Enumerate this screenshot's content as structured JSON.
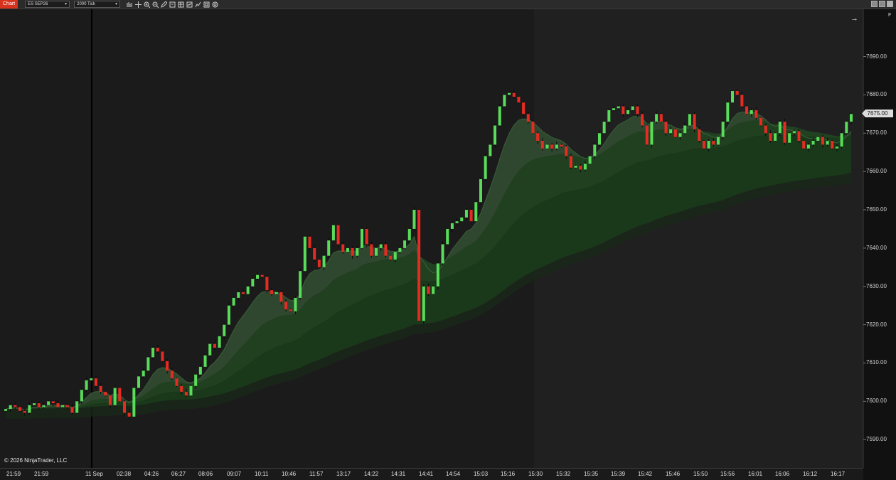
{
  "window": {
    "tab_label": "Chart"
  },
  "toolbar": {
    "instrument": "ES SEP26",
    "period": "2000 Tick",
    "icons": [
      "bar-type-icon",
      "crosshair-icon",
      "zoom-in-icon",
      "zoom-out-icon",
      "pencil-icon",
      "attach-order-icon",
      "data-box-icon",
      "indicators-icon",
      "strategies-icon",
      "chart-trader-icon",
      "properties-icon"
    ]
  },
  "colors": {
    "background": "#1b1b1b",
    "session_shade": "#202020",
    "up": "#59dc59",
    "down": "#e52c22",
    "ribbon_1": "#2f4a2f",
    "ribbon_2": "#214221",
    "ribbon_3": "#1a3a1a",
    "ribbon_4": "#1a2a1a"
  },
  "panel": {
    "copyright": "© 2026 NinjaTrader, LLC",
    "side_label": "F"
  },
  "price_axis": {
    "ticks": [
      "7690.00",
      "7680.00",
      "7670.00",
      "7660.00",
      "7650.00",
      "7640.00",
      "7630.00",
      "7620.00",
      "7610.00",
      "7600.00",
      "7590.00"
    ],
    "current_price": "7675.00"
  },
  "time_axis": {
    "labels": [
      "21:59",
      "21:59",
      "11 Sep",
      "02:38",
      "04:26",
      "06:27",
      "08:06",
      "09:07",
      "10:11",
      "10:46",
      "11:57",
      "13:17",
      "14:22",
      "14:31",
      "14:41",
      "14:54",
      "15:03",
      "15:16",
      "15:30",
      "15:32",
      "15:35",
      "15:39",
      "15:42",
      "15:46",
      "15:50",
      "15:56",
      "16:01",
      "16:06",
      "16:12",
      "16:17"
    ]
  },
  "chart_data": {
    "type": "candlestick",
    "y_axis_range": [
      7585,
      7700
    ],
    "session_break_label": "11 Sep",
    "closes": [
      7598.0,
      7599.0,
      7598.5,
      7597.5,
      7597.0,
      7599.0,
      7599.5,
      7598.5,
      7599.0,
      7600.0,
      7599.5,
      7598.5,
      7599.0,
      7598.5,
      7597.0,
      7600.0,
      7603.0,
      7605.5,
      7606.0,
      7604.0,
      7602.5,
      7601.5,
      7599.0,
      7603.5,
      7600.0,
      7597.0,
      7596.0,
      7603.5,
      7606.5,
      7608.0,
      7611.5,
      7614.0,
      7613.0,
      7610.5,
      7608.0,
      7606.0,
      7604.0,
      7602.5,
      7601.5,
      7604.0,
      7607.0,
      7609.0,
      7612.0,
      7615.0,
      7614.0,
      7617.0,
      7620.0,
      7625.0,
      7627.0,
      7628.5,
      7628.0,
      7630.0,
      7632.0,
      7633.0,
      7632.5,
      7629.0,
      7628.0,
      7628.5,
      7626.0,
      7624.0,
      7623.5,
      7627.0,
      7634.0,
      7643.0,
      7640.0,
      7637.0,
      7635.0,
      7638.0,
      7642.0,
      7646.0,
      7641.0,
      7639.0,
      7640.0,
      7638.0,
      7640.0,
      7645.0,
      7641.0,
      7638.0,
      7640.0,
      7641.0,
      7638.0,
      7637.0,
      7639.0,
      7640.0,
      7642.0,
      7645.0,
      7650.0,
      7621.0,
      7630.0,
      7628.0,
      7630.0,
      7636.0,
      7641.0,
      7645.0,
      7646.5,
      7647.0,
      7648.0,
      7650.0,
      7647.0,
      7652.0,
      7658.0,
      7664.0,
      7667.0,
      7672.0,
      7677.0,
      7680.0,
      7680.5,
      7679.5,
      7678.0,
      7675.0,
      7673.0,
      7670.0,
      7668.0,
      7666.0,
      7667.0,
      7666.0,
      7667.0,
      7666.5,
      7664.0,
      7661.0,
      7661.5,
      7660.5,
      7662.0,
      7664.0,
      7667.0,
      7670.0,
      7673.0,
      7676.0,
      7676.5,
      7677.0,
      7675.0,
      7676.0,
      7677.0,
      7675.0,
      7672.0,
      7667.0,
      7673.0,
      7675.0,
      7673.0,
      7670.0,
      7671.0,
      7669.0,
      7670.0,
      7672.0,
      7675.0,
      7671.0,
      7668.0,
      7666.0,
      7668.0,
      7667.0,
      7669.0,
      7673.0,
      7678.0,
      7681.0,
      7680.0,
      7677.0,
      7675.0,
      7676.0,
      7674.0,
      7672.0,
      7670.0,
      7668.0,
      7670.0,
      7673.0,
      7667.5,
      7670.0,
      7670.5,
      7668.0,
      7666.0,
      7667.0,
      7668.0,
      7669.0,
      7667.0,
      7668.0,
      7666.0,
      7666.5,
      7670.0,
      7673.0,
      7675.0
    ],
    "moving_averages": [
      {
        "period": "fast"
      },
      {
        "period": "medium"
      },
      {
        "period": "slow"
      },
      {
        "period": "slowest"
      }
    ]
  }
}
